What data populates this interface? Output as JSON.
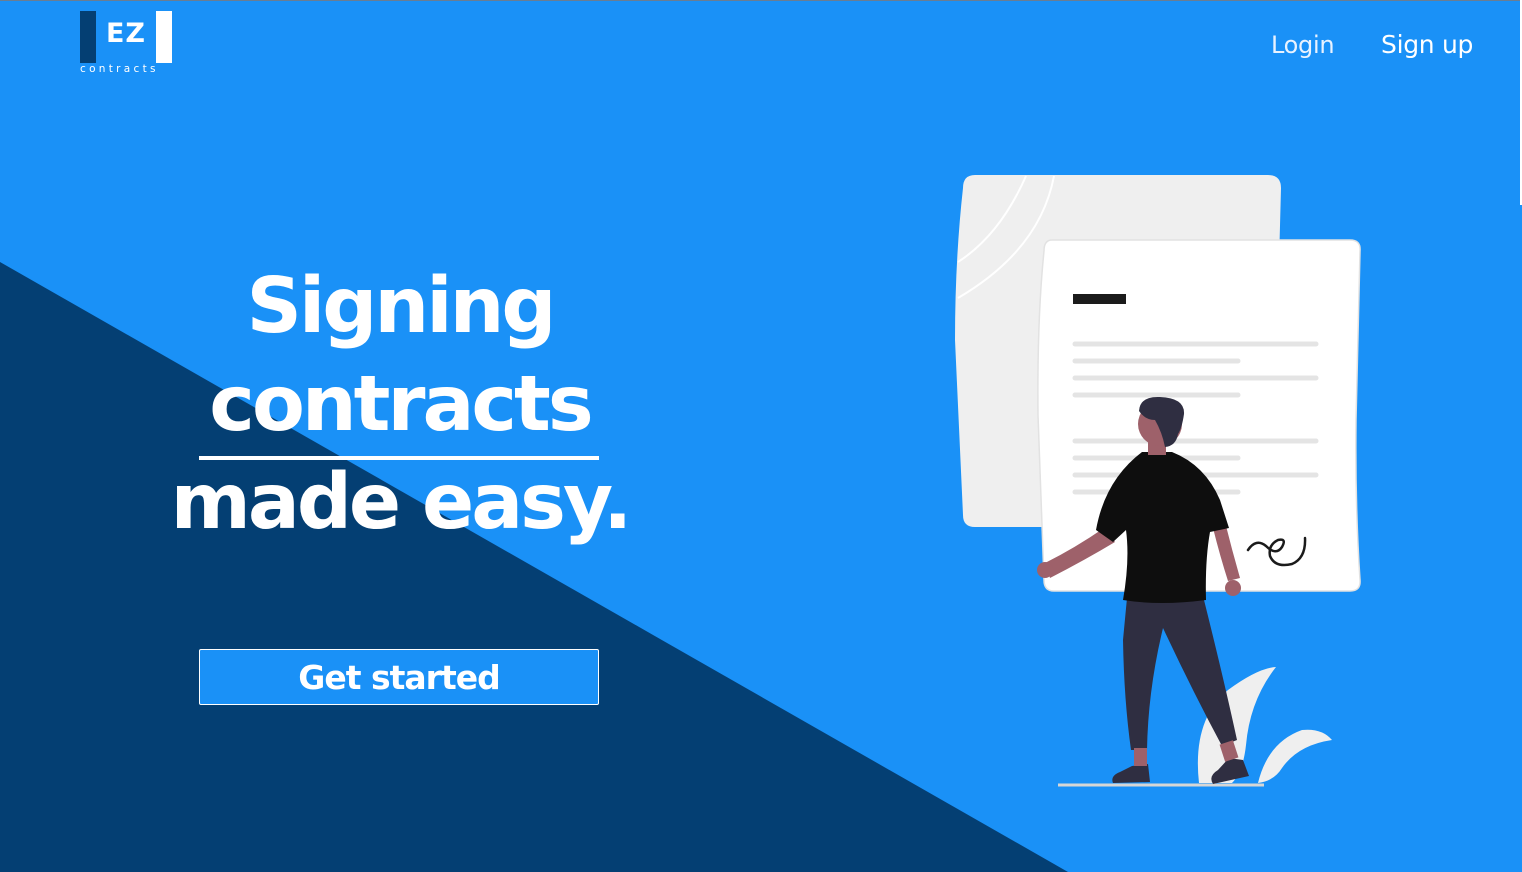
{
  "logo": {
    "mark": "EZ",
    "subtitle": "contracts"
  },
  "nav": {
    "login_label": "Login",
    "signup_label": "Sign up"
  },
  "hero": {
    "headline_line1": "Signing",
    "headline_line2": "contracts",
    "headline_line3": "made easy.",
    "cta_label": "Get started"
  },
  "colors": {
    "primary_blue": "#1a91f7",
    "dark_navy": "#043f73",
    "white": "#ffffff"
  },
  "illustration": {
    "icon": "person-signing-document-illustration"
  }
}
